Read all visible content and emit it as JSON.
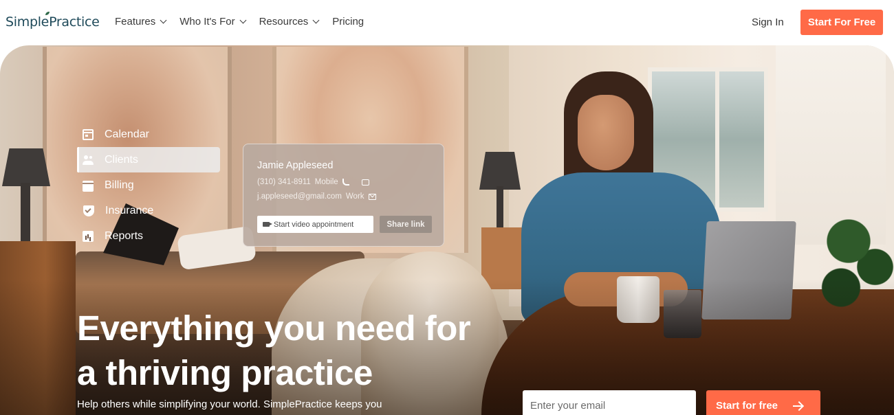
{
  "header": {
    "logo": "SimplePractice",
    "nav": [
      {
        "label": "Features",
        "has_dropdown": true
      },
      {
        "label": "Who It's For",
        "has_dropdown": true
      },
      {
        "label": "Resources",
        "has_dropdown": true
      },
      {
        "label": "Pricing",
        "has_dropdown": false
      }
    ],
    "sign_in": "Sign In",
    "cta": "Start For Free"
  },
  "hero": {
    "menu": [
      {
        "label": "Calendar",
        "icon": "calendar-icon",
        "active": false
      },
      {
        "label": "Clients",
        "icon": "clients-icon",
        "active": true
      },
      {
        "label": "Billing",
        "icon": "billing-icon",
        "active": false
      },
      {
        "label": "Insurance",
        "icon": "insurance-shield-icon",
        "active": false
      },
      {
        "label": "Reports",
        "icon": "reports-icon",
        "active": false
      }
    ],
    "contact_card": {
      "name": "Jamie Appleseed",
      "phone": "(310) 341-8911",
      "phone_type": "Mobile",
      "email": "j.appleseed@gmail.com",
      "email_type": "Work",
      "video_button": "Start video appointment",
      "share_button": "Share link"
    },
    "headline_line1": "Everything you need for",
    "headline_line2": "a thriving practice",
    "subtext": "Help others while simplifying your world. SimplePractice keeps you",
    "email_placeholder": "Enter your email",
    "cta": "Start for free"
  },
  "colors": {
    "brand_orange": "#ff6a47",
    "logo_teal": "#1f4a5a"
  }
}
